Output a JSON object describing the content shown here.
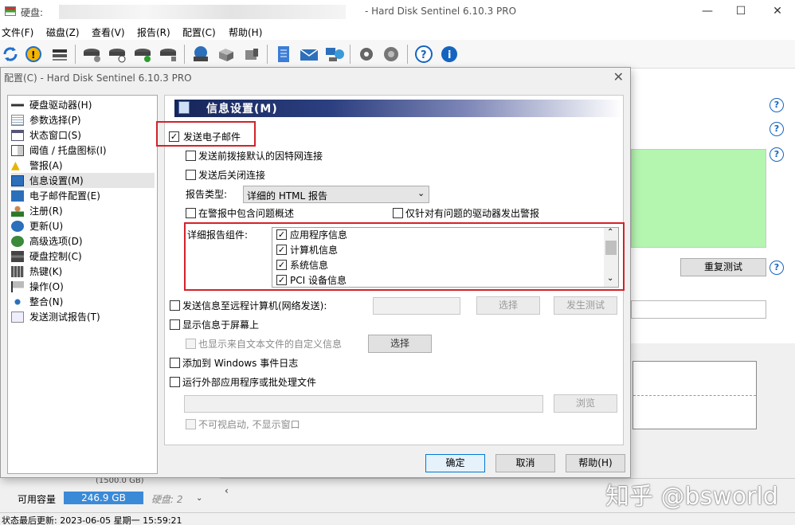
{
  "window": {
    "title_prefix": "硬盘:",
    "app_title": "- Hard Disk Sentinel 6.10.3 PRO",
    "min": "—",
    "max": "☐",
    "close": "✕"
  },
  "menu": [
    "文件(F)",
    "磁盘(Z)",
    "查看(V)",
    "报告(R)",
    "配置(C)",
    "帮助(H)"
  ],
  "toolbar_icons": [
    "refresh-icon",
    "alert-icon",
    "disk-icon",
    "disk-test-icon",
    "disk-clock-icon",
    "disk-check-icon",
    "disk-tool-icon",
    "globe-disk-icon",
    "drives-icon",
    "drive-icon",
    "notepad-icon",
    "mail-icon",
    "network-icon",
    "gear-icon",
    "sound-icon",
    "help-icon",
    "info-icon"
  ],
  "main": {
    "retest_button": "重复测试",
    "help_icon": "?",
    "capacity_label": "可用容量",
    "capacity_value": "246.9 GB",
    "disk_label": "硬盘: 2",
    "partial_size": "(1500.0 GB)"
  },
  "statusbar": {
    "text": "状态最后更新:  2023-06-05 星期一 15:59:21"
  },
  "dialog": {
    "title": "配置(C)  -  Hard Disk Sentinel 6.10.3 PRO",
    "close": "✕",
    "tree": [
      {
        "label": "硬盘驱动器(H)",
        "icon": "hdd-icon"
      },
      {
        "label": "参数选择(P)",
        "icon": "doc-icon"
      },
      {
        "label": "状态窗口(S)",
        "icon": "window-icon"
      },
      {
        "label": "阈值 / 托盘图标(I)",
        "icon": "threshold-icon"
      },
      {
        "label": "警报(A)",
        "icon": "warning-icon"
      },
      {
        "label": "信息设置(M)",
        "icon": "info-settings-icon",
        "selected": true
      },
      {
        "label": "电子邮件配置(E)",
        "icon": "email-icon"
      },
      {
        "label": "注册(R)",
        "icon": "user-icon"
      },
      {
        "label": "更新(U)",
        "icon": "globe-icon"
      },
      {
        "label": "高级选项(D)",
        "icon": "advanced-icon"
      },
      {
        "label": "硬盘控制(C)",
        "icon": "disk-control-icon"
      },
      {
        "label": "热键(K)",
        "icon": "keyboard-icon"
      },
      {
        "label": "操作(O)",
        "icon": "flag-icon"
      },
      {
        "label": "整合(N)",
        "icon": "network-icon"
      },
      {
        "label": "发送测试报告(T)",
        "icon": "report-icon"
      }
    ],
    "header": "信息设置(M)",
    "send_email": "发送电子邮件",
    "dial_before": "发送前拨接默认的因特网连接",
    "close_after": "发送后关闭连接",
    "report_type_label": "报告类型:",
    "report_type_value": "详细的 HTML 报告",
    "include_overview": "在警报中包含问题概述",
    "only_problem": "仅针对有问题的驱动器发出警报",
    "components_label": "详细报告组件:",
    "components": [
      "应用程序信息",
      "计算机信息",
      "系统信息",
      "PCI 设备信息"
    ],
    "send_remote": "发送信息至远程计算机(网络发送):",
    "select_button": "选择",
    "send_test_button": "发生测试",
    "show_screen": "显示信息于屏幕上",
    "show_custom": "也显示来自文本文件的自定义信息",
    "select_button2": "选择",
    "add_eventlog": "添加到 Windows 事件日志",
    "run_external": "运行外部应用程序或批处理文件",
    "browse_button": "浏览",
    "invisible_start": "不可视启动, 不显示窗口",
    "ok": "确定",
    "cancel": "取消",
    "help": "帮助(H)"
  },
  "watermark": "知乎 @bsworld",
  "colors": {
    "accent": "#1565c0",
    "highlight_red": "#d2232a",
    "green_panel": "#b4f5b0",
    "header_dark": "#16265a"
  }
}
